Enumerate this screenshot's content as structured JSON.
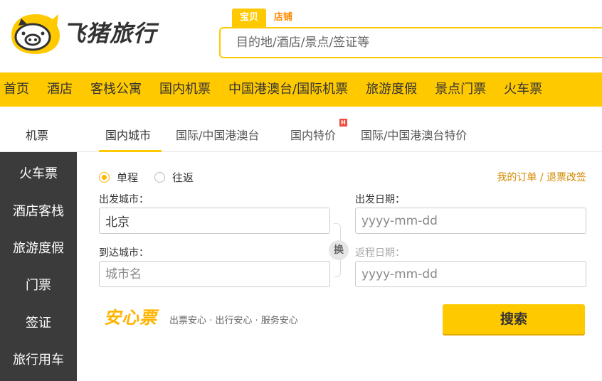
{
  "brand": {
    "name": "飞猪旅行"
  },
  "search": {
    "tabs": [
      {
        "label": "宝贝"
      },
      {
        "label": "店铺"
      }
    ],
    "placeholder": "目的地/酒店/景点/签证等"
  },
  "nav": {
    "items": [
      {
        "label": "首页"
      },
      {
        "label": "酒店"
      },
      {
        "label": "客栈公寓"
      },
      {
        "label": "国内机票"
      },
      {
        "label": "中国港澳台/国际机票"
      },
      {
        "label": "旅游度假"
      },
      {
        "label": "景点门票"
      },
      {
        "label": "火车票"
      }
    ]
  },
  "subnav": {
    "category": "机票",
    "tabs": [
      {
        "label": "国内城市"
      },
      {
        "label": "国际/中国港澳台"
      },
      {
        "label": "国内特价",
        "badge": "H"
      },
      {
        "label": "国际/中国港澳台特价"
      }
    ]
  },
  "sidebar": {
    "items": [
      {
        "label": "火车票"
      },
      {
        "label": "酒店客栈"
      },
      {
        "label": "旅游度假"
      },
      {
        "label": "门票"
      },
      {
        "label": "签证"
      },
      {
        "label": "旅行用车"
      }
    ]
  },
  "form": {
    "trip_types": [
      {
        "label": "单程",
        "selected": true
      },
      {
        "label": "往返",
        "selected": false
      }
    ],
    "my_orders": "我的订单 / 退票改签",
    "depart_city_label": "出发城市：",
    "depart_city_value": "北京",
    "arrive_city_label": "到达城市：",
    "arrive_city_placeholder": "城市名",
    "depart_date_label": "出发日期：",
    "depart_date_placeholder": "yyyy-mm-dd",
    "return_date_label": "返程日期：",
    "return_date_placeholder": "yyyy-mm-dd",
    "swap_label": "换",
    "anxin_logo": "安心票",
    "anxin_desc": "出票安心 · 出行安心 · 服务安心",
    "search_button": "搜索"
  },
  "colors": {
    "accent": "#ffc900",
    "sidebar": "#3b3b3b",
    "link": "#d28a00"
  }
}
